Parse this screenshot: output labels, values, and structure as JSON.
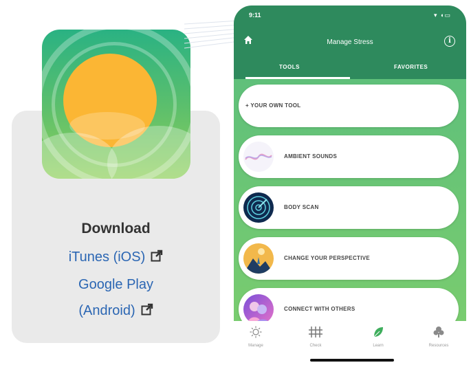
{
  "download": {
    "title": "Download",
    "links": [
      {
        "label": "iTunes (iOS)"
      },
      {
        "label": "Google Play"
      },
      {
        "label": "(Android)"
      }
    ]
  },
  "phone": {
    "status_time": "9:11",
    "status_icons": "▾ ◖▭",
    "header_title": "Manage Stress",
    "tabs": [
      {
        "label": "TOOLS",
        "active": true
      },
      {
        "label": "FAVORITES",
        "active": false
      }
    ],
    "tools": [
      {
        "label": "+ YOUR OWN TOOL"
      },
      {
        "label": "AMBIENT SOUNDS"
      },
      {
        "label": "BODY SCAN"
      },
      {
        "label": "CHANGE YOUR PERSPECTIVE"
      },
      {
        "label": "CONNECT WITH OTHERS"
      }
    ],
    "nav": [
      {
        "label": "Manage",
        "icon": "sun-icon"
      },
      {
        "label": "Check",
        "icon": "fence-icon"
      },
      {
        "label": "Learn",
        "icon": "leaf-icon"
      },
      {
        "label": "Resources",
        "icon": "tree-icon"
      }
    ]
  },
  "colors": {
    "brand_green": "#2e8a5d",
    "list_green": "#5fc07a",
    "link_blue": "#2b66b3",
    "sun_yellow": "#fbb634"
  }
}
